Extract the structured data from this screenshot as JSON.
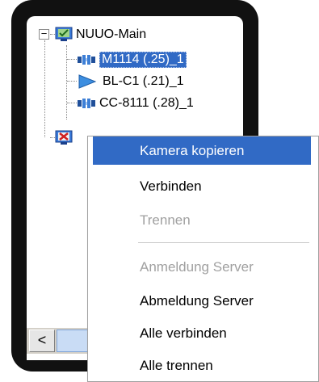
{
  "tree": {
    "root_label": "NUUO-Main",
    "items": [
      {
        "label": "M1114 (.25)_1",
        "icon": "dome-camera-icon",
        "selected": true
      },
      {
        "label": "BL-C1 (.21)_1",
        "icon": "ptz-camera-icon",
        "selected": false
      },
      {
        "label": "CC-8111 (.28)_1",
        "icon": "dome-camera-icon",
        "selected": false
      }
    ],
    "second_root_icon": "disconnected-server-icon"
  },
  "colors": {
    "selection": "#316ac5",
    "disabled_text": "#a0a0a0",
    "frame": "#111111"
  },
  "context_menu": {
    "items": [
      {
        "label": "Kamera kopieren",
        "state": "highlighted"
      },
      {
        "label": "Verbinden",
        "state": "enabled"
      },
      {
        "label": "Trennen",
        "state": "disabled"
      },
      {
        "label": "Anmeldung Server",
        "state": "disabled"
      },
      {
        "label": "Abmeldung Server",
        "state": "enabled"
      },
      {
        "label": "Alle verbinden",
        "state": "enabled"
      },
      {
        "label": "Alle trennen",
        "state": "enabled"
      }
    ]
  },
  "scrollbar": {
    "left_arrow": "<"
  }
}
